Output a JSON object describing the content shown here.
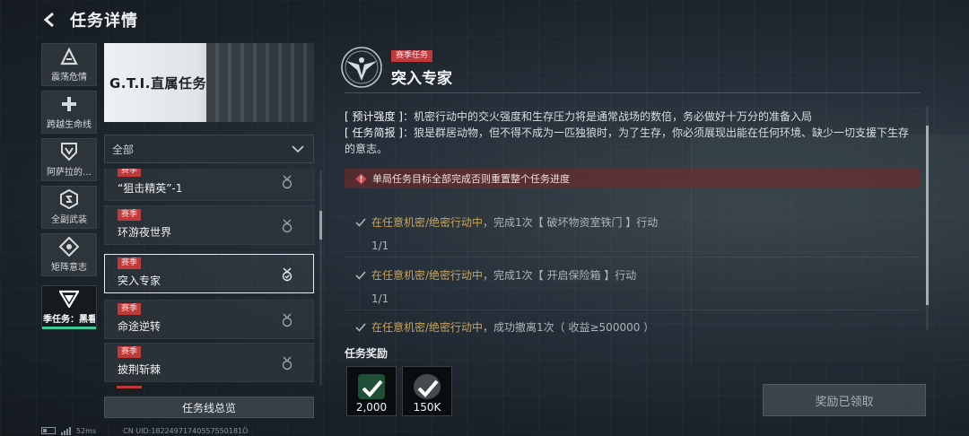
{
  "header": {
    "title": "任务详情"
  },
  "tabs": [
    {
      "label": "震荡危情",
      "icon": "triangle-a-icon"
    },
    {
      "label": "跨越生命线",
      "icon": "plus-cross-icon"
    },
    {
      "label": "阿萨拉的…",
      "icon": "shield-v-icon"
    },
    {
      "label": "全副武装",
      "icon": "hexagon-s-icon"
    },
    {
      "label": "矩阵意志",
      "icon": "diamond-target-icon"
    },
    {
      "label": "季任务：黑看",
      "icon": "triangle-down-icon",
      "active": true
    }
  ],
  "banner": {
    "title": "G.T.I.直属任务"
  },
  "filter": {
    "selected": "全部"
  },
  "missions": [
    {
      "tag": "赛季",
      "name": "“狙击精英”-1"
    },
    {
      "tag": "赛季",
      "name": "环游夜世界"
    },
    {
      "tag": "赛季",
      "name": "突入专家",
      "active": true
    },
    {
      "tag": "赛季",
      "name": "命途逆转"
    },
    {
      "tag": "赛季",
      "name": "披荆斩棘"
    }
  ],
  "overview_button": "任务线总览",
  "status": {
    "ping": "52ms",
    "uid": "CN UID:18224971740557550181Ö"
  },
  "detail": {
    "tag": "赛季任务",
    "title": "突入专家",
    "desc_intensity_key": "[ 预计强度 ]",
    "desc_intensity": "：机密行动中的交火强度和生存压力将是通常战场的数倍，务必做好十万分的准备入局",
    "desc_brief_key": "[ 任务简报 ]",
    "desc_brief": "：狼是群居动物，但不得不成为一匹独狼时，为了生存，你必须展现出能在任何环境、缺少一切支援下生存的意志。",
    "warning": "单局任务目标全部完成否则重置整个任务进度",
    "objectives": [
      {
        "mode": "在任意机密/绝密行动中",
        "text": "，完成1次【 破坏物资室铁门 】行动",
        "progress": "1/1"
      },
      {
        "mode": "在任意机密/绝密行动中",
        "text": "，完成1次【 开启保险箱 】行动",
        "progress": "1/1"
      },
      {
        "mode": "在任意机密/绝密行动中",
        "text": "，成功撤离1次（ 收益≥500000 ）",
        "progress": ""
      }
    ],
    "rewards_title": "任务奖励",
    "rewards": [
      {
        "value": "2,000",
        "icon": "currency-card-icon",
        "color": "#2f7a55"
      },
      {
        "value": "150K",
        "icon": "coin-stack-icon",
        "color": "#6b7377"
      }
    ],
    "claim_button": "奖励已领取"
  },
  "colors": {
    "accent": "#3fc89a",
    "season_red": "#c03a3a",
    "highlight_gold": "#c9a45a"
  }
}
